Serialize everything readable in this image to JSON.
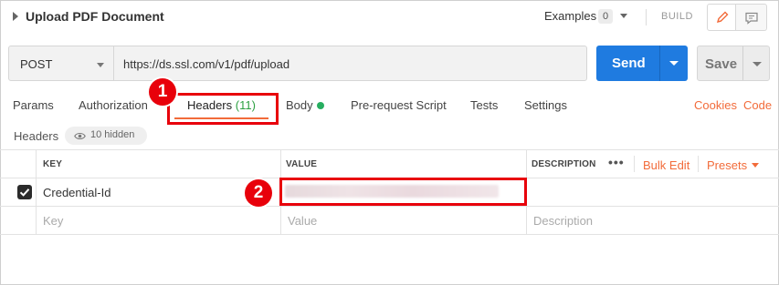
{
  "header": {
    "title": "Upload PDF Document",
    "examples_label": "Examples",
    "examples_count": "0",
    "build_label": "BUILD"
  },
  "request": {
    "method": "POST",
    "url": "https://ds.ssl.com/v1/pdf/upload",
    "send_label": "Send",
    "save_label": "Save"
  },
  "tabs": [
    {
      "label": "Params"
    },
    {
      "label": "Authorization"
    },
    {
      "label": "Headers",
      "count": "(11)"
    },
    {
      "label": "Body"
    },
    {
      "label": "Pre-request Script"
    },
    {
      "label": "Tests"
    },
    {
      "label": "Settings"
    }
  ],
  "links": {
    "cookies": "Cookies",
    "code": "Code"
  },
  "headers_section": {
    "label": "Headers",
    "hidden_badge": "10 hidden"
  },
  "table": {
    "columns": [
      "KEY",
      "VALUE",
      "DESCRIPTION"
    ],
    "more": "•••",
    "bulk_edit": "Bulk Edit",
    "presets": "Presets",
    "rows": [
      {
        "checked": true,
        "key": "Credential-Id",
        "value": "",
        "description": ""
      }
    ],
    "placeholders": {
      "key": "Key",
      "value": "Value",
      "description": "Description"
    }
  },
  "annotations": {
    "one": "1",
    "two": "2",
    "color": "#e8000b"
  },
  "colors": {
    "accent": "#f26b3a",
    "send": "#1f7be0",
    "count": "#2ea043"
  }
}
